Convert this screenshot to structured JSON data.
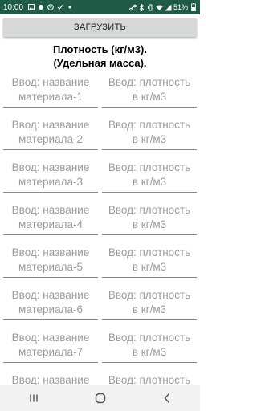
{
  "status_bar": {
    "time": "10:00",
    "battery": "51%",
    "icons": [
      "image-icon",
      "notification-dot-icon",
      "vpn-icon",
      "check-icon",
      "dot-icon",
      "link-icon",
      "bluetooth-icon",
      "vibrate-icon",
      "wifi-icon",
      "signal-icon",
      "battery-icon"
    ]
  },
  "load_button": {
    "label": "ЗАГРУЗИТЬ"
  },
  "title": {
    "line1": "Плотность (кг/м3).",
    "line2": "(Удельная масса)."
  },
  "rows": [
    {
      "name_line1": "Ввод: название",
      "name_line2": "материала-1",
      "density_line1": "Ввод: плотность",
      "density_line2": "в кг/м3"
    },
    {
      "name_line1": "Ввод: название",
      "name_line2": "материала-2",
      "density_line1": "Ввод: плотность",
      "density_line2": "в кг/м3"
    },
    {
      "name_line1": "Ввод: название",
      "name_line2": "материала-3",
      "density_line1": "Ввод: плотность",
      "density_line2": "в кг/м3"
    },
    {
      "name_line1": "Ввод: название",
      "name_line2": "материала-4",
      "density_line1": "Ввод: плотность",
      "density_line2": "в кг/м3"
    },
    {
      "name_line1": "Ввод: название",
      "name_line2": "материала-5",
      "density_line1": "Ввод: плотность",
      "density_line2": "в кг/м3"
    },
    {
      "name_line1": "Ввод: название",
      "name_line2": "материала-6",
      "density_line1": "Ввод: плотность",
      "density_line2": "в кг/м3"
    },
    {
      "name_line1": "Ввод: название",
      "name_line2": "материала-7",
      "density_line1": "Ввод: плотность",
      "density_line2": "в кг/м3"
    },
    {
      "name_line1": "Ввод: название",
      "name_line2": "",
      "density_line1": "Ввод: плотность",
      "density_line2": ""
    }
  ],
  "nav_bar": {
    "icons": [
      "recents-icon",
      "home-icon",
      "back-icon"
    ]
  }
}
